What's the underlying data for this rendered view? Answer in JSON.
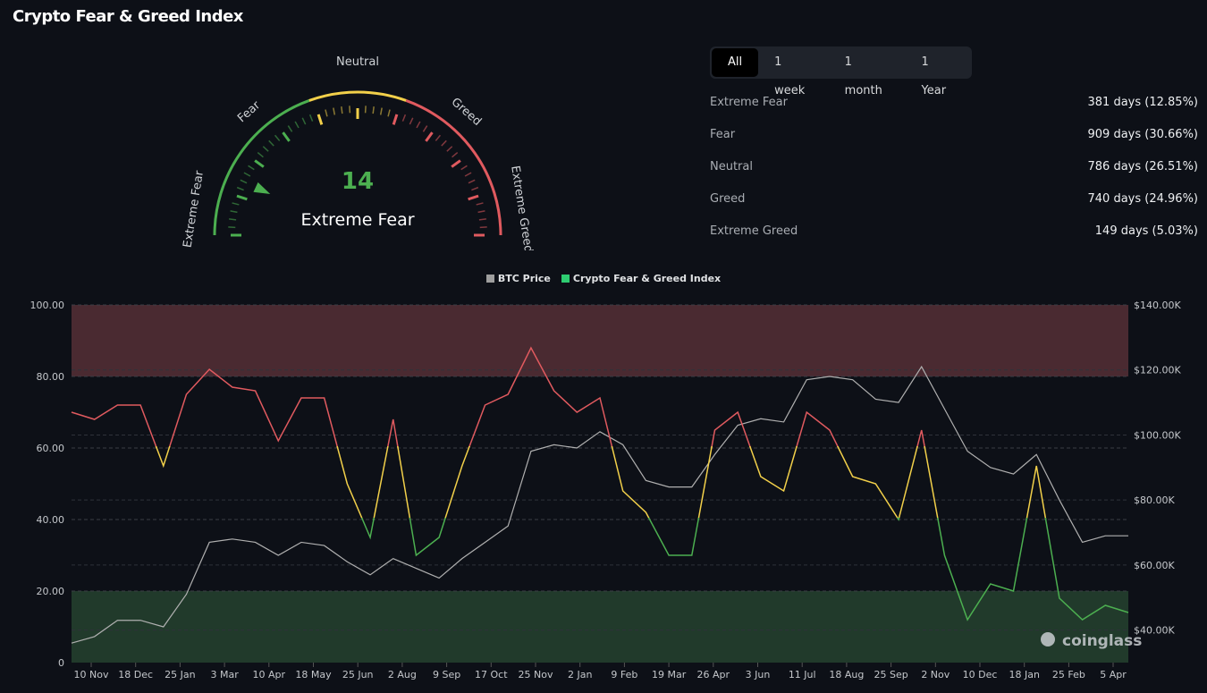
{
  "title": "Crypto Fear & Greed Index",
  "gauge": {
    "value": 14,
    "value_text": "14",
    "classification": "Extreme Fear",
    "labels": [
      "Extreme Fear",
      "Fear",
      "Neutral",
      "Greed",
      "Extreme Greed"
    ],
    "colors": {
      "fear": "#4caf50",
      "neutral": "#f2d04a",
      "greed": "#e05a5f"
    }
  },
  "tabs": [
    {
      "label": "All",
      "active": true
    },
    {
      "label": "1 week"
    },
    {
      "label": "1 month"
    },
    {
      "label": "1 Year"
    }
  ],
  "stats": [
    {
      "label": "Extreme Fear",
      "value": "381 days (12.85%)"
    },
    {
      "label": "Fear",
      "value": "909 days (30.66%)"
    },
    {
      "label": "Neutral",
      "value": "786 days (26.51%)"
    },
    {
      "label": "Greed",
      "value": "740 days (24.96%)"
    },
    {
      "label": "Extreme Greed",
      "value": "149 days (5.03%)"
    }
  ],
  "watermark": "coinglass",
  "chart_data": {
    "type": "line",
    "legend": [
      {
        "name": "BTC Price",
        "color": "#9e9e9e"
      },
      {
        "name": "Crypto Fear & Greed Index",
        "color": "#2ecc71"
      }
    ],
    "legend_position": "top",
    "x_ticks": [
      "10 Nov",
      "18 Dec",
      "25 Jan",
      "3 Mar",
      "10 Apr",
      "18 May",
      "25 Jun",
      "2 Aug",
      "9 Sep",
      "17 Oct",
      "25 Nov",
      "2 Jan",
      "9 Feb",
      "19 Mar",
      "26 Apr",
      "3 Jun",
      "11 Jul",
      "18 Aug",
      "25 Sep",
      "2 Nov",
      "10 Dec",
      "18 Jan",
      "25 Feb",
      "5 Apr"
    ],
    "y_left": {
      "ticks": [
        "0",
        "20.00",
        "40.00",
        "60.00",
        "80.00",
        "100.00"
      ],
      "range": [
        0,
        100
      ]
    },
    "y_right": {
      "ticks": [
        "$40.00K",
        "$60.00K",
        "$80.00K",
        "$100.00K",
        "$120.00K",
        "$140.00K"
      ],
      "range_k": [
        30,
        140
      ]
    },
    "bands": [
      {
        "from": 80,
        "to": 100,
        "color": "#4a2a31"
      },
      {
        "from": 0,
        "to": 20,
        "color": "#213a2b"
      }
    ],
    "thresholds": {
      "green_below": 40,
      "yellow_below": 60
    },
    "line_colors": {
      "high": "#e05a5f",
      "mid": "#f2d04a",
      "low": "#4caf50",
      "price": "#b0b0b0"
    },
    "index_series": [
      70,
      68,
      72,
      72,
      55,
      75,
      82,
      77,
      76,
      62,
      74,
      74,
      50,
      35,
      68,
      30,
      35,
      55,
      72,
      75,
      88,
      76,
      70,
      74,
      48,
      42,
      30,
      30,
      65,
      70,
      52,
      48,
      70,
      65,
      52,
      50,
      40,
      65,
      30,
      12,
      22,
      20,
      55,
      18,
      12,
      16,
      14
    ],
    "btc_price_k": [
      36,
      38,
      43,
      43,
      41,
      51,
      67,
      68,
      67,
      63,
      67,
      66,
      61,
      57,
      62,
      59,
      56,
      62,
      67,
      72,
      95,
      97,
      96,
      101,
      97,
      86,
      84,
      84,
      94,
      103,
      105,
      104,
      117,
      118,
      117,
      111,
      110,
      121,
      108,
      95,
      90,
      88,
      94,
      80,
      67,
      69,
      69
    ]
  }
}
